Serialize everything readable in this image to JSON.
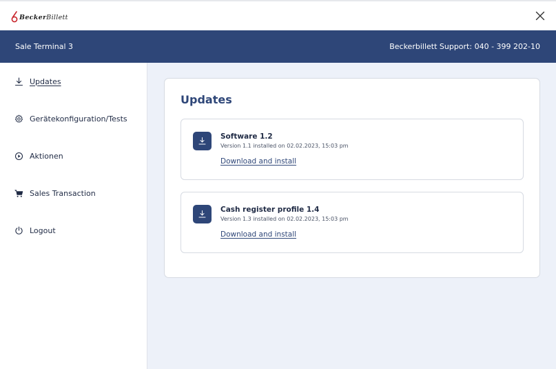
{
  "titlebar": {
    "logo_part1": "Becker",
    "logo_part2": "Billett"
  },
  "header": {
    "terminal": "Sale Terminal 3",
    "support": "Beckerbillett Support: 040 - 399 202-10"
  },
  "sidebar": {
    "items": [
      {
        "label": "Updates",
        "icon": "download-icon",
        "active": true
      },
      {
        "label": "Gerätekonfiguration/Tests",
        "icon": "gear-icon",
        "active": false
      },
      {
        "label": "Aktionen",
        "icon": "play-circle-icon",
        "active": false
      },
      {
        "label": "Sales Transaction",
        "icon": "cart-icon",
        "active": false
      },
      {
        "label": "Logout",
        "icon": "power-icon",
        "active": false
      }
    ]
  },
  "main": {
    "title": "Updates",
    "updates": [
      {
        "title": "Software 1.2",
        "subtitle": "Version 1.1 installed on 02.02.2023, 15:03 pm",
        "action": "Download and install"
      },
      {
        "title": "Cash register profile 1.4",
        "subtitle": "Version 1.3 installed on 02.02.2023, 15:03 pm",
        "action": "Download and install"
      }
    ]
  },
  "colors": {
    "brand": "#2e4678",
    "background": "#edf1f9",
    "logo_red": "#c8242b"
  }
}
